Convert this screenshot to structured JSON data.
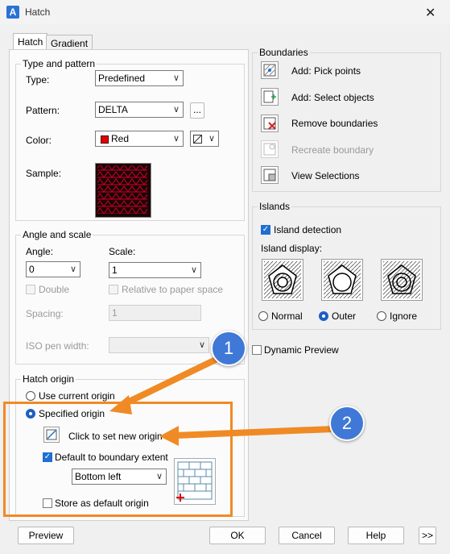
{
  "window": {
    "title": "Hatch",
    "close": "✕"
  },
  "tabs": [
    {
      "label": "Hatch"
    },
    {
      "label": "Gradient"
    }
  ],
  "type_pattern": {
    "legend": "Type and pattern",
    "type_label": "Type:",
    "type_value": "Predefined",
    "pattern_label": "Pattern:",
    "pattern_value": "DELTA",
    "browse_label": "...",
    "color_label": "Color:",
    "color_value": "Red",
    "color_swatch": "#e00000",
    "sample_label": "Sample:"
  },
  "angle_scale": {
    "legend": "Angle and scale",
    "angle_label": "Angle:",
    "angle_value": "0",
    "scale_label": "Scale:",
    "scale_value": "1",
    "double_label": "Double",
    "relative_label": "Relative to paper space",
    "spacing_label": "Spacing:",
    "spacing_value": "1",
    "iso_label": "ISO pen width:"
  },
  "hatch_origin": {
    "legend": "Hatch origin",
    "use_current": "Use current origin",
    "specified": "Specified origin",
    "click_set": "Click to set new origin",
    "default_boundary": "Default to boundary extent",
    "position_value": "Bottom left",
    "store_default": "Store as default origin"
  },
  "boundaries": {
    "legend": "Boundaries",
    "items": [
      {
        "label": "Add: Pick points"
      },
      {
        "label": "Add: Select objects"
      },
      {
        "label": "Remove boundaries"
      },
      {
        "label": "Recreate boundary"
      },
      {
        "label": "View Selections"
      }
    ]
  },
  "islands": {
    "legend": "Islands",
    "detection": "Island detection",
    "display_label": "Island display:",
    "options": [
      {
        "label": "Normal"
      },
      {
        "label": "Outer"
      },
      {
        "label": "Ignore"
      }
    ]
  },
  "dynamic_preview": "Dynamic Preview",
  "callouts": [
    {
      "number": "1"
    },
    {
      "number": "2"
    }
  ],
  "footer": {
    "preview": "Preview",
    "ok": "OK",
    "cancel": "Cancel",
    "help": "Help",
    "more": ">>"
  },
  "colors": {
    "accent": "#1e6fd1",
    "callout": "#3f78d6",
    "arrow": "#f08a24"
  }
}
